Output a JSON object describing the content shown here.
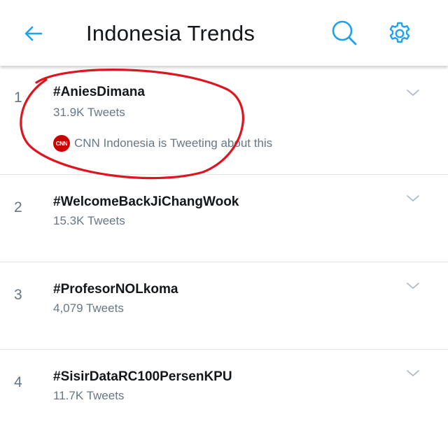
{
  "header": {
    "title": "Indonesia Trends",
    "back_icon": "back-arrow-icon",
    "search_icon": "search-icon",
    "settings_icon": "gear-icon"
  },
  "colors": {
    "accent": "#1da1f2",
    "text_primary": "#14171a",
    "text_secondary": "#657786",
    "divider": "#e1e8ed",
    "annotation": "#e0141e",
    "cnn_red": "#cc0000"
  },
  "trends": [
    {
      "rank": "1",
      "name": "#AniesDimana",
      "count": "31.9K Tweets",
      "context": {
        "avatar_label": "CNN",
        "text": "CNN Indonesia is Tweeting about this"
      }
    },
    {
      "rank": "2",
      "name": "#WelcomeBackJiChangWook",
      "count": "15.3K Tweets"
    },
    {
      "rank": "3",
      "name": "#ProfesorNOLkoma",
      "count": "4,079 Tweets"
    },
    {
      "rank": "4",
      "name": "#SisirDataRC100PersenKPU",
      "count": "11.7K Tweets"
    }
  ]
}
